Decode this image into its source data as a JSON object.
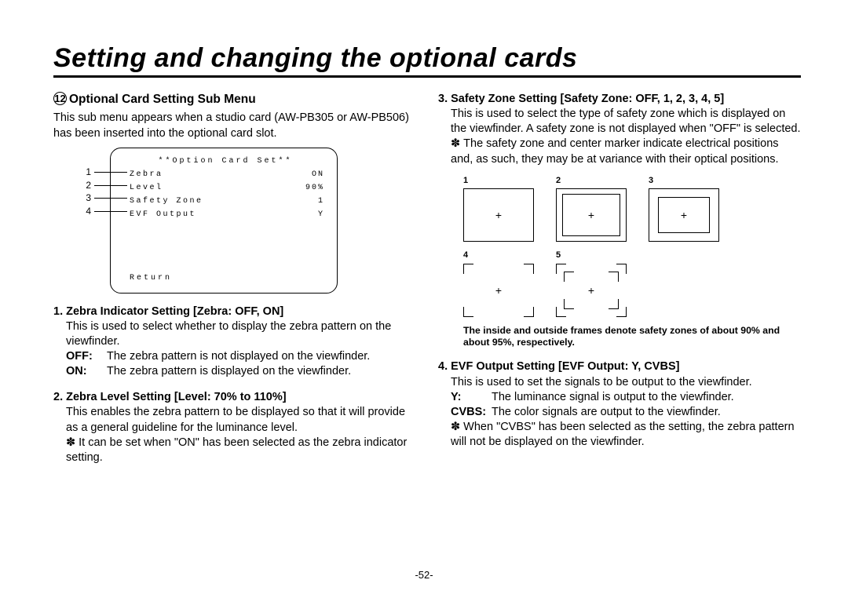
{
  "page_title": "Setting and changing the optional cards",
  "page_number": "-52-",
  "left": {
    "section_number": "12",
    "section_title": "Optional Card Setting Sub Menu",
    "intro": "This sub menu appears when a studio card (AW-PB305 or AW-PB506) has been inserted into the optional card slot.",
    "osd": {
      "title": "**Option Card Set**",
      "rows": [
        {
          "num": "1",
          "label": "Zebra",
          "value": "ON"
        },
        {
          "num": "2",
          "label": "Level",
          "value": "90%"
        },
        {
          "num": "3",
          "label": "Safety Zone",
          "value": "1"
        },
        {
          "num": "4",
          "label": "EVF Output",
          "value": "Y"
        }
      ],
      "return": "Return"
    },
    "items": [
      {
        "head": "1.  Zebra Indicator Setting [Zebra: OFF, ON]",
        "body": "This is used to select whether to display the zebra pattern on the viewfinder.",
        "defs": [
          {
            "k": "OFF:",
            "v": "The zebra pattern is not displayed on the viewfinder."
          },
          {
            "k": "ON:",
            "v": "The zebra pattern is displayed on the viewfinder."
          }
        ]
      },
      {
        "head": "2.  Zebra Level Setting [Level: 70% to 110%]",
        "body": "This enables the zebra pattern to be displayed so that it will provide as a general guideline for the luminance level.",
        "note": "It can be set when \"ON\" has been selected as the zebra indicator setting."
      }
    ]
  },
  "right": {
    "items": [
      {
        "head": "3.  Safety Zone Setting [Safety Zone: OFF, 1, 2, 3, 4, 5]",
        "body": "This is used to select the type of safety zone which is displayed on the viewfinder. A safety zone is not displayed when \"OFF\" is selected.",
        "note": "The safety zone and center marker indicate electrical positions and, as such, they may be at variance with their optical positions."
      }
    ],
    "sz_labels": {
      "1": "1",
      "2": "2",
      "3": "3",
      "4": "4",
      "5": "5"
    },
    "sz_caption": "The inside and outside frames denote safety zones of about 90% and about 95%, respectively.",
    "item4": {
      "head": "4.  EVF Output Setting [EVF Output: Y, CVBS]",
      "body": "This is used to set the signals to be output to the viewfinder.",
      "defs": [
        {
          "k": "Y:",
          "v": "The luminance signal is output to the viewfinder."
        },
        {
          "k": "CVBS:",
          "v": "The color signals are output to the viewfinder."
        }
      ],
      "note": "When \"CVBS\" has been selected as the setting, the zebra pattern will not be displayed on the viewfinder."
    }
  }
}
